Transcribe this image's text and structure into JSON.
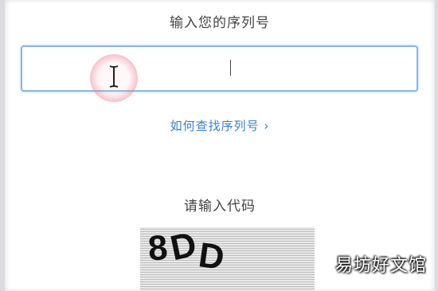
{
  "serial": {
    "label": "输入您的序列号",
    "value": "",
    "help_link": "如何查找序列号 ›"
  },
  "code": {
    "label": "请输入代码",
    "captcha_chars": [
      "8",
      "D",
      "D"
    ]
  },
  "watermark": "易坊好文馆",
  "colors": {
    "input_border": "#86b8e3",
    "link": "#3a7fd0"
  }
}
